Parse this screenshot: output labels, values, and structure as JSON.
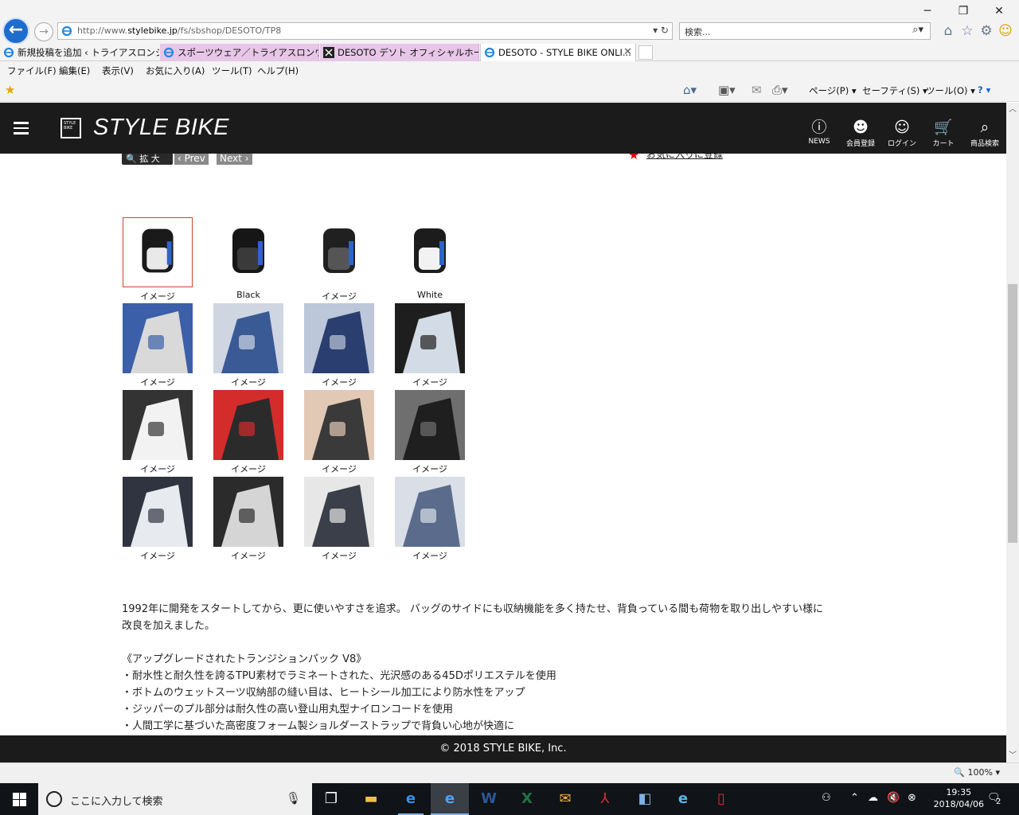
{
  "window": {
    "minimize": "─",
    "restore": "❐",
    "close": "✕"
  },
  "address": {
    "url_prefix": "http://www.",
    "url_domain": "stylebike.jp",
    "url_path": "/fs/sbshop/DESOTO/TP8",
    "tools": "▾ ↻"
  },
  "search": {
    "placeholder": "検索...",
    "icon": "⌕▾"
  },
  "tabs": [
    {
      "label": "新規投稿を追加 ‹ トライアスロンシ...",
      "favicon": "ie"
    },
    {
      "label": "スポーツウェア／トライアスロンウェア...",
      "favicon": "ie"
    },
    {
      "label": "DESOTO デソト オフィシャルホーム...",
      "favicon": "desoto"
    },
    {
      "label": "DESOTO - STYLE BIKE ONLI...",
      "favicon": "ie",
      "active": true
    }
  ],
  "menu": [
    "ファイル(F)",
    "編集(E)",
    "表示(V)",
    "お気に入り(A)",
    "ツール(T)",
    "ヘルプ(H)"
  ],
  "commandbar": {
    "page": "ページ(P) ▾",
    "safety": "セーフティ(S) ▾",
    "tools": "ツール(O) ▾",
    "help": "? ▾"
  },
  "header": {
    "logo_text": "STYLE BIKE",
    "logo_mark": "STYLE BIKE",
    "nav": [
      {
        "icon": "info-icon",
        "glyph": "ⓘ",
        "label": "NEWS"
      },
      {
        "icon": "register-icon",
        "glyph": "☻",
        "label": "会員登録"
      },
      {
        "icon": "login-icon",
        "glyph": "☺",
        "label": "ログイン"
      },
      {
        "icon": "cart-icon",
        "glyph": "🛒",
        "label": "カート"
      },
      {
        "icon": "search-icon",
        "glyph": "⌕",
        "label": "商品検索"
      }
    ]
  },
  "gallery_controls": {
    "zoom": "🔍 拡 大",
    "prev": "‹ Prev",
    "next": "Next ›",
    "favorite": "お気に入りに登録"
  },
  "thumbnails": [
    {
      "caption": "イメージ",
      "selected": true
    },
    {
      "caption": "Black"
    },
    {
      "caption": "イメージ"
    },
    {
      "caption": "White"
    },
    {
      "caption": "イメージ"
    },
    {
      "caption": "イメージ"
    },
    {
      "caption": "イメージ"
    },
    {
      "caption": "イメージ"
    },
    {
      "caption": "イメージ"
    },
    {
      "caption": "イメージ"
    },
    {
      "caption": "イメージ"
    },
    {
      "caption": "イメージ"
    },
    {
      "caption": "イメージ"
    },
    {
      "caption": "イメージ"
    },
    {
      "caption": "イメージ"
    },
    {
      "caption": "イメージ"
    }
  ],
  "description": {
    "intro_1": "1992年に開発をスタートしてから、更に使いやすさを追求。 バッグのサイドにも収納機能を多く持たせ、背負っている間も荷物を取り出しやすい様に",
    "intro_2": "改良を加えました。",
    "heading": "《アップグレードされたトランジションパック V8》",
    "bullets": [
      "・耐水性と耐久性を誇るTPU素材でラミネートされた、光沢感のある45Dポリエステルを使用",
      "・ボトムのウェットスーツ収納部の縫い目は、ヒートシール加工により防水性をアップ",
      "・ジッパーのプル部分は耐久性の高い登山用丸型ナイロンコードを使用",
      "・人間工学に基づいた高密度フォーム製ショルダーストラップで背負い心地が快適に"
    ]
  },
  "footer": {
    "copyright": "© 2018 STYLE BIKE, Inc."
  },
  "status": {
    "zoom": "🔍 100%  ▾"
  },
  "taskbar": {
    "search_placeholder": "ここに入力して検索",
    "time": "19:35",
    "date": "2018/04/06",
    "notifications": "2"
  }
}
